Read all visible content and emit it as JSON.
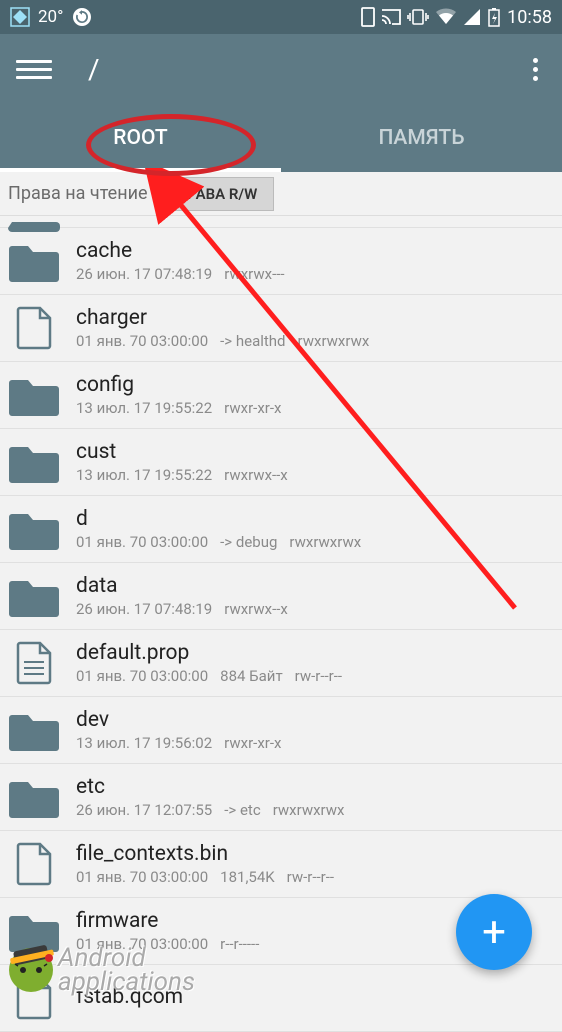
{
  "status": {
    "temp": "20°",
    "time": "10:58"
  },
  "appbar": {
    "path": "/"
  },
  "tabs": {
    "root": "ROOT",
    "memory": "ПАМЯТЬ"
  },
  "perms": {
    "label": "Права на чтение",
    "button": "ПРАВА R/W"
  },
  "files": [
    {
      "name": "cache",
      "date": "26 июн. 17 07:48:19",
      "perm": "rwxrwx---",
      "type": "folder"
    },
    {
      "name": "charger",
      "date": "01 янв. 70 03:00:00",
      "extra": "-> healthd",
      "perm": "rwxrwxrwx",
      "type": "file-blank"
    },
    {
      "name": "config",
      "date": "13 июл. 17 19:55:22",
      "perm": "rwxr-xr-x",
      "type": "folder"
    },
    {
      "name": "cust",
      "date": "13 июл. 17 19:55:22",
      "perm": "rwxrwx--x",
      "type": "folder"
    },
    {
      "name": "d",
      "date": "01 янв. 70 03:00:00",
      "extra": "-> debug",
      "perm": "rwxrwxrwx",
      "type": "folder"
    },
    {
      "name": "data",
      "date": "26 июн. 17 07:48:19",
      "perm": "rwxrwx--x",
      "type": "folder"
    },
    {
      "name": "default.prop",
      "date": "01 янв. 70 03:00:00",
      "size": "884 Байт",
      "perm": "rw-r--r--",
      "type": "file-text"
    },
    {
      "name": "dev",
      "date": "13 июл. 17 19:56:02",
      "perm": "rwxr-xr-x",
      "type": "folder"
    },
    {
      "name": "etc",
      "date": "26 июн. 17 12:07:55",
      "extra": "-> etc",
      "perm": "rwxrwxrwx",
      "type": "folder"
    },
    {
      "name": "file_contexts.bin",
      "date": "01 янв. 70 03:00:00",
      "size": "181,54K",
      "perm": "rw-r--r--",
      "type": "file-blank"
    },
    {
      "name": "firmware",
      "date": "01 янв. 70 03:00:00",
      "perm": "r--r-----",
      "type": "folder"
    },
    {
      "name": "fstab.qcom",
      "date": "",
      "perm": "",
      "type": "file-blank"
    }
  ],
  "watermark": {
    "line1": "Android",
    "line2": "applications"
  },
  "fab": {
    "label": "+"
  }
}
